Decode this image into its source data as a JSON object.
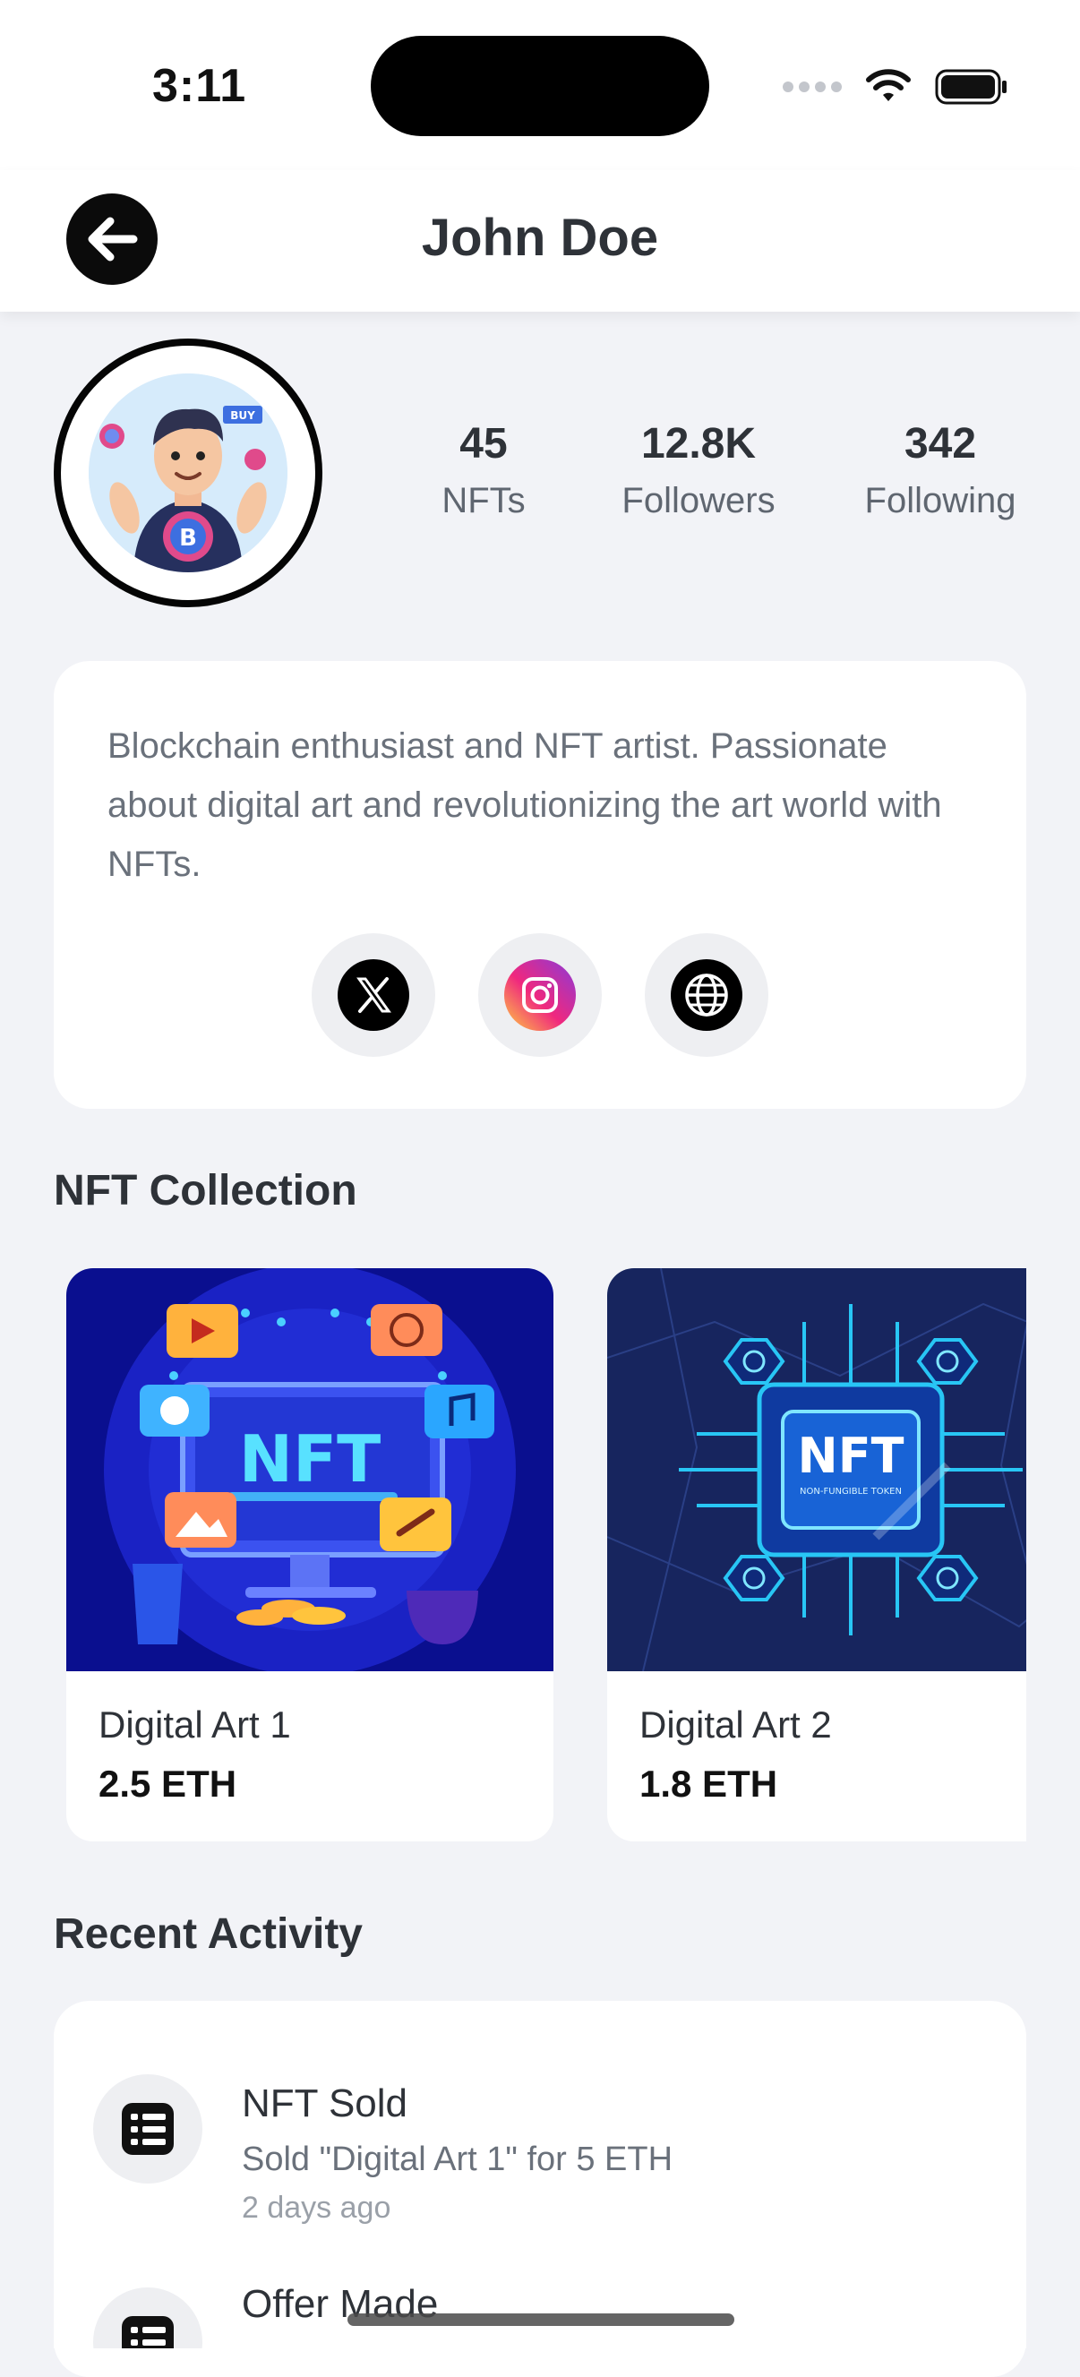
{
  "status_bar": {
    "time": "3:11"
  },
  "header": {
    "title": "John Doe",
    "back_icon": "arrow-left-icon"
  },
  "profile": {
    "stats": [
      {
        "value": "45",
        "label": "NFTs"
      },
      {
        "value": "12.8K",
        "label": "Followers"
      },
      {
        "value": "342",
        "label": "Following"
      }
    ],
    "avatar_badge": "BUY",
    "bio": "Blockchain enthusiast and NFT artist. Passionate about digital art and revolutionizing the art world with NFTs.",
    "socials": [
      "x-logo-icon",
      "instagram-icon",
      "globe-icon"
    ]
  },
  "collection": {
    "title": "NFT Collection",
    "items": [
      {
        "name": "Digital Art 1",
        "price": "2.5 ETH",
        "art_text": "NFT"
      },
      {
        "name": "Digital Art 2",
        "price": "1.8 ETH",
        "art_text": "NFT",
        "art_subtext": "NON-FUNGIBLE TOKEN"
      }
    ]
  },
  "activity": {
    "title": "Recent Activity",
    "items": [
      {
        "title": "NFT Sold",
        "description": "Sold \"Digital Art 1\" for 5 ETH",
        "time": "2 days ago",
        "icon": "list-icon"
      },
      {
        "title": "Offer Made",
        "icon": "list-icon"
      }
    ]
  },
  "colors": {
    "background": "#f2f3f7",
    "card": "#ffffff",
    "primary_text": "#2e3238",
    "secondary_text": "#6a717b",
    "art1_bg": "#1b23c9",
    "art2_bg": "#17255e",
    "art2_accent": "#28c6f5"
  }
}
